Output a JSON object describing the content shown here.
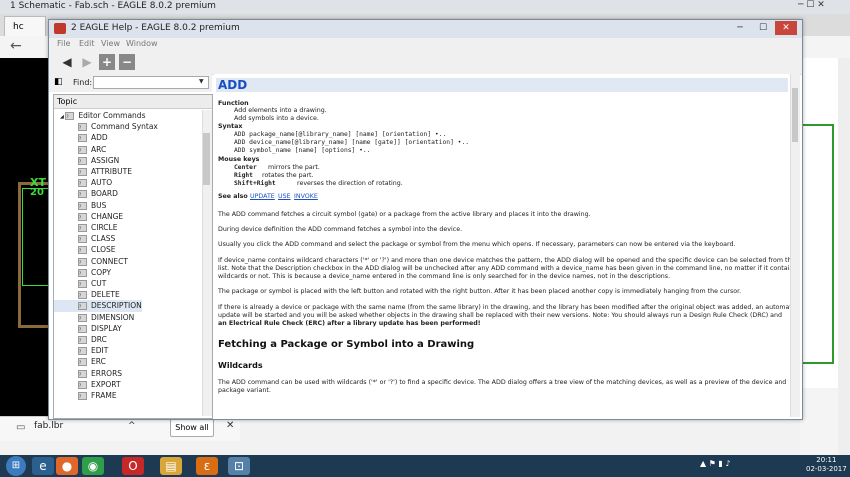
{
  "browser": {
    "title": "1 Schematic - Fab.sch - EAGLE 8.0.2 premium",
    "tab_label": "hc",
    "download": {
      "file": "fab.lbr",
      "show_all": "Show all"
    }
  },
  "schematic": {
    "label_xt": "XT",
    "label_20": "20"
  },
  "help": {
    "title": "2 EAGLE Help - EAGLE 8.0.2 premium",
    "menu": [
      "File",
      "Edit",
      "View",
      "Window"
    ],
    "find_label": "Find:",
    "topic_header": "Topic",
    "tree": [
      "Editor Commands",
      "Command Syntax",
      "ADD",
      "ARC",
      "ASSIGN",
      "ATTRIBUTE",
      "AUTO",
      "BOARD",
      "BUS",
      "CHANGE",
      "CIRCLE",
      "CLASS",
      "CLOSE",
      "CONNECT",
      "COPY",
      "CUT",
      "DELETE",
      "DESCRIPTION",
      "DIMENSION",
      "DISPLAY",
      "DRC",
      "EDIT",
      "ERC",
      "ERRORS",
      "EXPORT",
      "FRAME"
    ],
    "content": {
      "title": "ADD",
      "function_h": "Function",
      "function_1": "Add elements into a drawing.",
      "function_2": "Add symbols into a device.",
      "syntax_h": "Syntax",
      "syntax_1": "ADD package_name[@library_name] [name] [orientation] •..",
      "syntax_2": "ADD device_name[@library_name] [name [gate]] [orientation] •..",
      "syntax_3": "ADD symbol_name [name] [options] •..",
      "mouse_h": "Mouse keys",
      "key_1": "Center",
      "key_1_desc": "mirrors the part.",
      "key_2": "Right",
      "key_2_desc": "rotates the part.",
      "key_3": "Shift+Right",
      "key_3_desc": "reverses the direction of rotating.",
      "see_also": "See also",
      "see_1": "UPDATE",
      "see_2": "USE",
      "see_3": "INVOKE",
      "p1": "The ADD command fetches a circuit symbol (gate) or a package from the active library and places it into the drawing.",
      "p2": "During device definition the ADD command fetches a symbol into the device.",
      "p3": "Usually you click the ADD command and select the package or symbol from the menu which opens. If necessary, parameters can now be entered via the keyboard.",
      "p4a": "If device_name contains wildcard characters ('*' or '?') and more than one device matches the pattern, the ADD dialog will be opened and the specific device can be selected from the",
      "p4b": "list. Note that the Description checkbox in the ADD dialog will be unchecked after any ADD command with a device_name has been given in the command line, no matter if it contains",
      "p4c": "wildcards or not. This is because a device_name entered in the command line is only searched for in the device names, not in the descriptions.",
      "p5": "The package or symbol is placed with the left button and rotated with the right button. After it has been placed another copy is immediately hanging from the cursor.",
      "p6a": "If there is already a device or package with the same name (from the same library) in the drawing, and the library has been modified after the original object was added, an automatic library",
      "p6b": "update will be started and you will be asked whether objects in the drawing shall be replaced with their new versions. Note: You should always run a Design Rule Check (DRC) and",
      "p6c": "an Electrical Rule Check (ERC) after a library update has been performed!",
      "h2": "Fetching a Package or Symbol into a Drawing",
      "h3": "Wildcards",
      "p7a": "The ADD command can be used with wildcards ('*' or '?') to find a specific device. The ADD dialog offers a tree view of the matching devices, as well as a preview of the device and",
      "p7b": "package variant."
    }
  },
  "taskbar": {
    "time": "20:11",
    "date": "02-03-2017"
  }
}
